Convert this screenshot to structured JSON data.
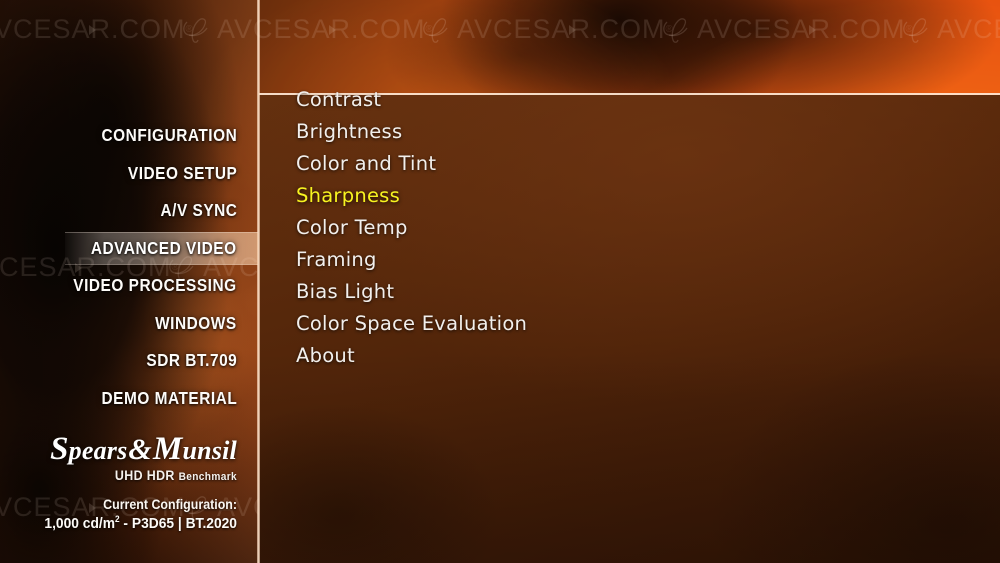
{
  "screen": {
    "title": "Spears & Munsil UHD HDR Benchmark",
    "accent_highlight": "#f7f320",
    "panel_bg": "#5a2a0c",
    "background_orange": "#e8520f"
  },
  "watermark": {
    "text": "AVCESAR.COM",
    "registered": "®",
    "icon": "avcesar-logo-icon",
    "play_icon": "play-triangle-icon"
  },
  "sidebar": {
    "items": [
      {
        "label": "Configuration",
        "selected": false
      },
      {
        "label": "Video Setup",
        "selected": false
      },
      {
        "label": "A/V Sync",
        "selected": false
      },
      {
        "label": "Advanced Video",
        "selected": true
      },
      {
        "label": "Video Processing",
        "selected": false
      },
      {
        "label": "Windows",
        "selected": false
      },
      {
        "label": "SDR BT.709",
        "selected": false
      },
      {
        "label": "Demo Material",
        "selected": false
      }
    ],
    "logo": {
      "brand_s": "S",
      "brand_pears": "pears",
      "brand_amp": "&",
      "brand_m": "M",
      "brand_unsil": "unsil",
      "subtitle_uhd": "UHD HDR ",
      "subtitle_benchmark": "Benchmark",
      "config_title": "Current Configuration:",
      "config_value_pre": "1,000 cd/m",
      "config_value_sup": "2",
      "config_value_post": " - P3D65 | BT.2020"
    }
  },
  "panel": {
    "menu": [
      {
        "label": "Contrast",
        "selected": false
      },
      {
        "label": "Brightness",
        "selected": false
      },
      {
        "label": "Color and Tint",
        "selected": false
      },
      {
        "label": "Sharpness",
        "selected": true
      },
      {
        "label": "Color Temp",
        "selected": false
      },
      {
        "label": "Framing",
        "selected": false
      },
      {
        "label": "Bias Light",
        "selected": false
      },
      {
        "label": "Color Space Evaluation",
        "selected": false
      },
      {
        "label": "About",
        "selected": false
      }
    ]
  }
}
